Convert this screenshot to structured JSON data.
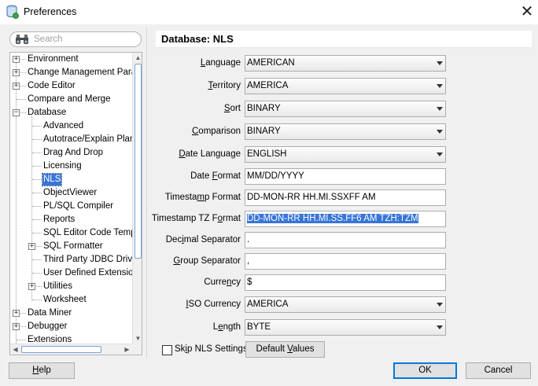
{
  "window": {
    "title": "Preferences",
    "close_glyph": "✕"
  },
  "search": {
    "placeholder": "Search"
  },
  "tree": {
    "items": [
      {
        "label": "Environment",
        "expandable": true,
        "level": 0
      },
      {
        "label": "Change Management Param",
        "expandable": true,
        "level": 0
      },
      {
        "label": "Code Editor",
        "expandable": true,
        "level": 0
      },
      {
        "label": "Compare and Merge",
        "expandable": false,
        "level": 0
      },
      {
        "label": "Database",
        "expandable": true,
        "expanded": true,
        "level": 0
      },
      {
        "label": "Advanced",
        "expandable": false,
        "level": 1
      },
      {
        "label": "Autotrace/Explain Plan",
        "expandable": false,
        "level": 1
      },
      {
        "label": "Drag And Drop",
        "expandable": false,
        "level": 1
      },
      {
        "label": "Licensing",
        "expandable": false,
        "level": 1
      },
      {
        "label": "NLS",
        "expandable": false,
        "level": 1,
        "selected": true
      },
      {
        "label": "ObjectViewer",
        "expandable": false,
        "level": 1
      },
      {
        "label": "PL/SQL Compiler",
        "expandable": false,
        "level": 1
      },
      {
        "label": "Reports",
        "expandable": false,
        "level": 1
      },
      {
        "label": "SQL Editor Code Templa",
        "expandable": false,
        "level": 1
      },
      {
        "label": "SQL Formatter",
        "expandable": true,
        "level": 1
      },
      {
        "label": "Third Party JDBC Driver",
        "expandable": false,
        "level": 1
      },
      {
        "label": "User Defined Extension",
        "expandable": false,
        "level": 1
      },
      {
        "label": "Utilities",
        "expandable": true,
        "level": 1
      },
      {
        "label": "Worksheet",
        "expandable": false,
        "level": 1
      },
      {
        "label": "Data Miner",
        "expandable": true,
        "level": 0
      },
      {
        "label": "Debugger",
        "expandable": true,
        "level": 0
      },
      {
        "label": "Extensions",
        "expandable": false,
        "level": 0
      }
    ]
  },
  "panel": {
    "title": "Database: NLS",
    "fields": {
      "language": {
        "label_pre": "",
        "label_key": "L",
        "label_post": "anguage",
        "value": "AMERICAN"
      },
      "territory": {
        "label_pre": "",
        "label_key": "T",
        "label_post": "erritory",
        "value": "AMERICA"
      },
      "sort": {
        "label_pre": "",
        "label_key": "S",
        "label_post": "ort",
        "value": "BINARY"
      },
      "comparison": {
        "label_pre": "",
        "label_key": "C",
        "label_post": "omparison",
        "value": "BINARY"
      },
      "date_language": {
        "label_pre": "",
        "label_key": "D",
        "label_post": "ate Language",
        "value": "ENGLISH"
      },
      "date_format": {
        "label_pre": "Date ",
        "label_key": "F",
        "label_post": "ormat",
        "value": "MM/DD/YYYY"
      },
      "timestamp_format": {
        "label_pre": "Timesta",
        "label_key": "m",
        "label_post": "p Format",
        "value": "DD-MON-RR HH.MI.SSXFF AM"
      },
      "timestamp_tz_format": {
        "label_pre": "Timestamp TZ F",
        "label_key": "o",
        "label_post": "rmat",
        "value": "DD-MON-RR HH.MI.SS.FF6 AM TZH:TZM"
      },
      "decimal_separator": {
        "label_pre": "Dec",
        "label_key": "i",
        "label_post": "mal Separator",
        "value": "."
      },
      "group_separator": {
        "label_pre": "",
        "label_key": "G",
        "label_post": "roup Separator",
        "value": ","
      },
      "currency": {
        "label_pre": "Curre",
        "label_key": "n",
        "label_post": "cy",
        "value": "$"
      },
      "iso_currency": {
        "label_pre": "",
        "label_key": "I",
        "label_post": "SO Currency",
        "value": "AMERICA"
      },
      "length": {
        "label_pre": "L",
        "label_key": "e",
        "label_post": "ngth",
        "value": "BYTE"
      }
    },
    "skip_nls": {
      "label_pre": "Sk",
      "label_key": "i",
      "label_post": "p NLS Settings",
      "checked": false
    },
    "default_values": {
      "label_pre": "Default ",
      "label_key": "V",
      "label_post": "alues"
    }
  },
  "buttons": {
    "help": {
      "label_key": "H",
      "label_post": "elp"
    },
    "ok": "OK",
    "cancel": "Cancel"
  },
  "colors": {
    "selection": "#3875d7",
    "default_button_border": "#0078d7"
  }
}
